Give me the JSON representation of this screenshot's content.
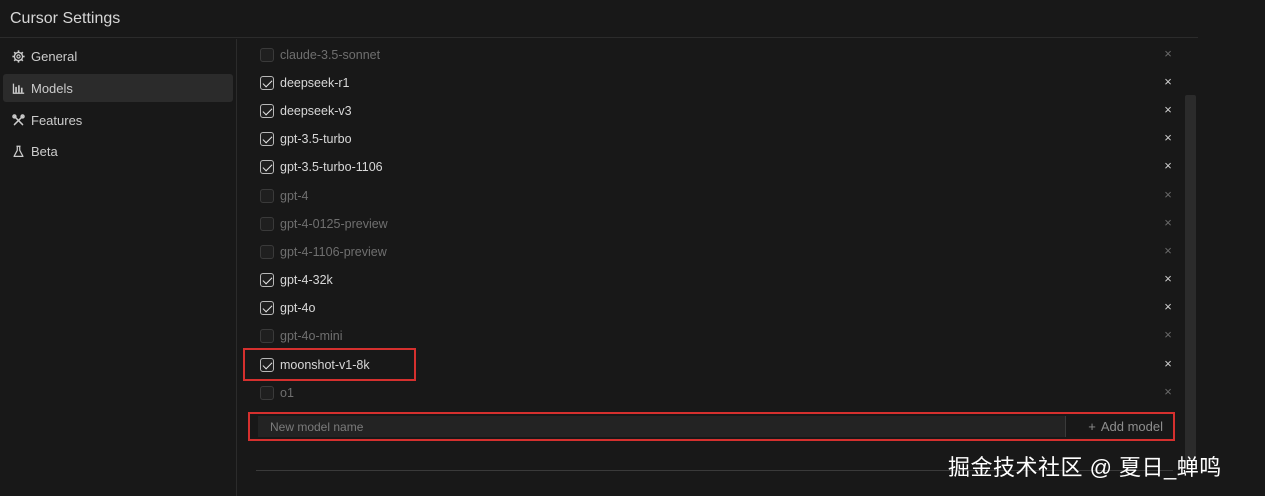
{
  "window": {
    "title": "Cursor Settings"
  },
  "sidebar": {
    "items": [
      {
        "label": "General",
        "icon": "gear-icon",
        "active": false
      },
      {
        "label": "Models",
        "icon": "bar-chart-icon",
        "active": true
      },
      {
        "label": "Features",
        "icon": "tools-icon",
        "active": false
      },
      {
        "label": "Beta",
        "icon": "flask-icon",
        "active": false
      }
    ]
  },
  "models": [
    {
      "name": "claude-3.5-sonnet",
      "enabled": false
    },
    {
      "name": "deepseek-r1",
      "enabled": true
    },
    {
      "name": "deepseek-v3",
      "enabled": true
    },
    {
      "name": "gpt-3.5-turbo",
      "enabled": true
    },
    {
      "name": "gpt-3.5-turbo-1106",
      "enabled": true
    },
    {
      "name": "gpt-4",
      "enabled": false
    },
    {
      "name": "gpt-4-0125-preview",
      "enabled": false
    },
    {
      "name": "gpt-4-1106-preview",
      "enabled": false
    },
    {
      "name": "gpt-4-32k",
      "enabled": true
    },
    {
      "name": "gpt-4o",
      "enabled": true
    },
    {
      "name": "gpt-4o-mini",
      "enabled": false
    },
    {
      "name": "moonshot-v1-8k",
      "enabled": true
    },
    {
      "name": "o1",
      "enabled": false
    }
  ],
  "add_model": {
    "placeholder": "New model name",
    "value": "",
    "button_label": "Add model",
    "button_icon": "plus-icon"
  },
  "watermark": "掘金技术社区 @ 夏日_蝉鸣",
  "colors": {
    "background": "#181818",
    "highlight_border": "#d5302e",
    "active_nav": "#2b2b2b"
  }
}
